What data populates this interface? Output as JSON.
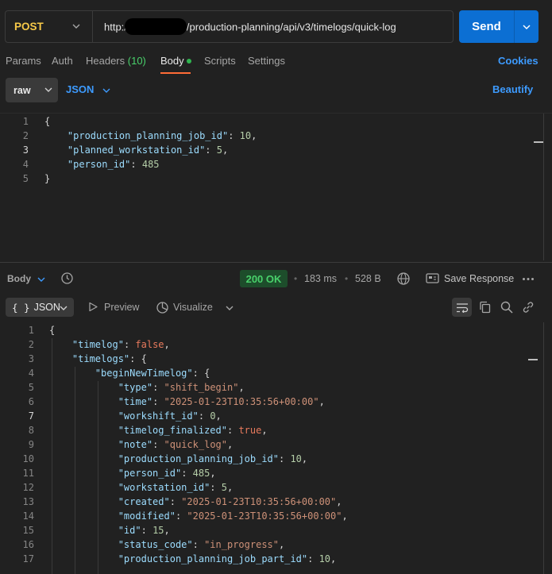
{
  "request": {
    "method": "POST",
    "url_prefix": "http:/",
    "url_suffix": "/production-planning/api/v3/timelogs/quick-log",
    "send_label": "Send"
  },
  "tabs": [
    {
      "label": "Params"
    },
    {
      "label": "Auth"
    },
    {
      "label": "Headers",
      "count": "(10)"
    },
    {
      "label": "Body"
    },
    {
      "label": "Scripts"
    },
    {
      "label": "Settings"
    }
  ],
  "cookies_label": "Cookies",
  "body_mode": "raw",
  "body_language": "JSON",
  "beautify_label": "Beautify",
  "request_body_lines": [
    [
      {
        "t": "p",
        "v": "{"
      }
    ],
    [
      {
        "t": "p",
        "v": "    "
      },
      {
        "t": "k",
        "v": "\"production_planning_job_id\""
      },
      {
        "t": "p",
        "v": ": "
      },
      {
        "t": "n",
        "v": "10"
      },
      {
        "t": "p",
        "v": ","
      }
    ],
    [
      {
        "t": "p",
        "v": "    "
      },
      {
        "t": "k",
        "v": "\"planned_workstation_id\""
      },
      {
        "t": "p",
        "v": ": "
      },
      {
        "t": "n",
        "v": "5"
      },
      {
        "t": "p",
        "v": ","
      }
    ],
    [
      {
        "t": "p",
        "v": "    "
      },
      {
        "t": "k",
        "v": "\"person_id\""
      },
      {
        "t": "p",
        "v": ": "
      },
      {
        "t": "n",
        "v": "485"
      }
    ],
    [
      {
        "t": "p",
        "v": "}"
      }
    ]
  ],
  "response": {
    "body_label": "Body",
    "status": "200 OK",
    "time": "183 ms",
    "size": "528 B",
    "save_label": "Save Response",
    "format_label": "JSON",
    "format_prefix": "{ }",
    "preview_label": "Preview",
    "visualize_label": "Visualize"
  },
  "response_body_lines": [
    [
      {
        "t": "p",
        "v": "{"
      }
    ],
    [
      {
        "t": "p",
        "v": "    "
      },
      {
        "t": "k",
        "v": "\"timelog\""
      },
      {
        "t": "p",
        "v": ": "
      },
      {
        "t": "b",
        "v": "false"
      },
      {
        "t": "p",
        "v": ","
      }
    ],
    [
      {
        "t": "p",
        "v": "    "
      },
      {
        "t": "k",
        "v": "\"timelogs\""
      },
      {
        "t": "p",
        "v": ": {"
      }
    ],
    [
      {
        "t": "p",
        "v": "        "
      },
      {
        "t": "k",
        "v": "\"beginNewTimelog\""
      },
      {
        "t": "p",
        "v": ": {"
      }
    ],
    [
      {
        "t": "p",
        "v": "            "
      },
      {
        "t": "k",
        "v": "\"type\""
      },
      {
        "t": "p",
        "v": ": "
      },
      {
        "t": "s",
        "v": "\"shift_begin\""
      },
      {
        "t": "p",
        "v": ","
      }
    ],
    [
      {
        "t": "p",
        "v": "            "
      },
      {
        "t": "k",
        "v": "\"time\""
      },
      {
        "t": "p",
        "v": ": "
      },
      {
        "t": "s",
        "v": "\"2025-01-23T10:35:56+00:00\""
      },
      {
        "t": "p",
        "v": ","
      }
    ],
    [
      {
        "t": "p",
        "v": "            "
      },
      {
        "t": "k",
        "v": "\"workshift_id\""
      },
      {
        "t": "p",
        "v": ": "
      },
      {
        "t": "n",
        "v": "0"
      },
      {
        "t": "p",
        "v": ","
      }
    ],
    [
      {
        "t": "p",
        "v": "            "
      },
      {
        "t": "k",
        "v": "\"timelog_finalized\""
      },
      {
        "t": "p",
        "v": ": "
      },
      {
        "t": "b",
        "v": "true"
      },
      {
        "t": "p",
        "v": ","
      }
    ],
    [
      {
        "t": "p",
        "v": "            "
      },
      {
        "t": "k",
        "v": "\"note\""
      },
      {
        "t": "p",
        "v": ": "
      },
      {
        "t": "s",
        "v": "\"quick_log\""
      },
      {
        "t": "p",
        "v": ","
      }
    ],
    [
      {
        "t": "p",
        "v": "            "
      },
      {
        "t": "k",
        "v": "\"production_planning_job_id\""
      },
      {
        "t": "p",
        "v": ": "
      },
      {
        "t": "n",
        "v": "10"
      },
      {
        "t": "p",
        "v": ","
      }
    ],
    [
      {
        "t": "p",
        "v": "            "
      },
      {
        "t": "k",
        "v": "\"person_id\""
      },
      {
        "t": "p",
        "v": ": "
      },
      {
        "t": "n",
        "v": "485"
      },
      {
        "t": "p",
        "v": ","
      }
    ],
    [
      {
        "t": "p",
        "v": "            "
      },
      {
        "t": "k",
        "v": "\"workstation_id\""
      },
      {
        "t": "p",
        "v": ": "
      },
      {
        "t": "n",
        "v": "5"
      },
      {
        "t": "p",
        "v": ","
      }
    ],
    [
      {
        "t": "p",
        "v": "            "
      },
      {
        "t": "k",
        "v": "\"created\""
      },
      {
        "t": "p",
        "v": ": "
      },
      {
        "t": "s",
        "v": "\"2025-01-23T10:35:56+00:00\""
      },
      {
        "t": "p",
        "v": ","
      }
    ],
    [
      {
        "t": "p",
        "v": "            "
      },
      {
        "t": "k",
        "v": "\"modified\""
      },
      {
        "t": "p",
        "v": ": "
      },
      {
        "t": "s",
        "v": "\"2025-01-23T10:35:56+00:00\""
      },
      {
        "t": "p",
        "v": ","
      }
    ],
    [
      {
        "t": "p",
        "v": "            "
      },
      {
        "t": "k",
        "v": "\"id\""
      },
      {
        "t": "p",
        "v": ": "
      },
      {
        "t": "n",
        "v": "15"
      },
      {
        "t": "p",
        "v": ","
      }
    ],
    [
      {
        "t": "p",
        "v": "            "
      },
      {
        "t": "k",
        "v": "\"status_code\""
      },
      {
        "t": "p",
        "v": ": "
      },
      {
        "t": "s",
        "v": "\"in_progress\""
      },
      {
        "t": "p",
        "v": ","
      }
    ],
    [
      {
        "t": "p",
        "v": "            "
      },
      {
        "t": "k",
        "v": "\"production_planning_job_part_id\""
      },
      {
        "t": "p",
        "v": ": "
      },
      {
        "t": "n",
        "v": "10"
      },
      {
        "t": "p",
        "v": ","
      }
    ]
  ],
  "colors": {
    "accent": "#0c6fd3",
    "link": "#3d9bff",
    "method": "#f7c948",
    "status_ok": "#49d16b",
    "tab_active": "#ff6c37"
  }
}
